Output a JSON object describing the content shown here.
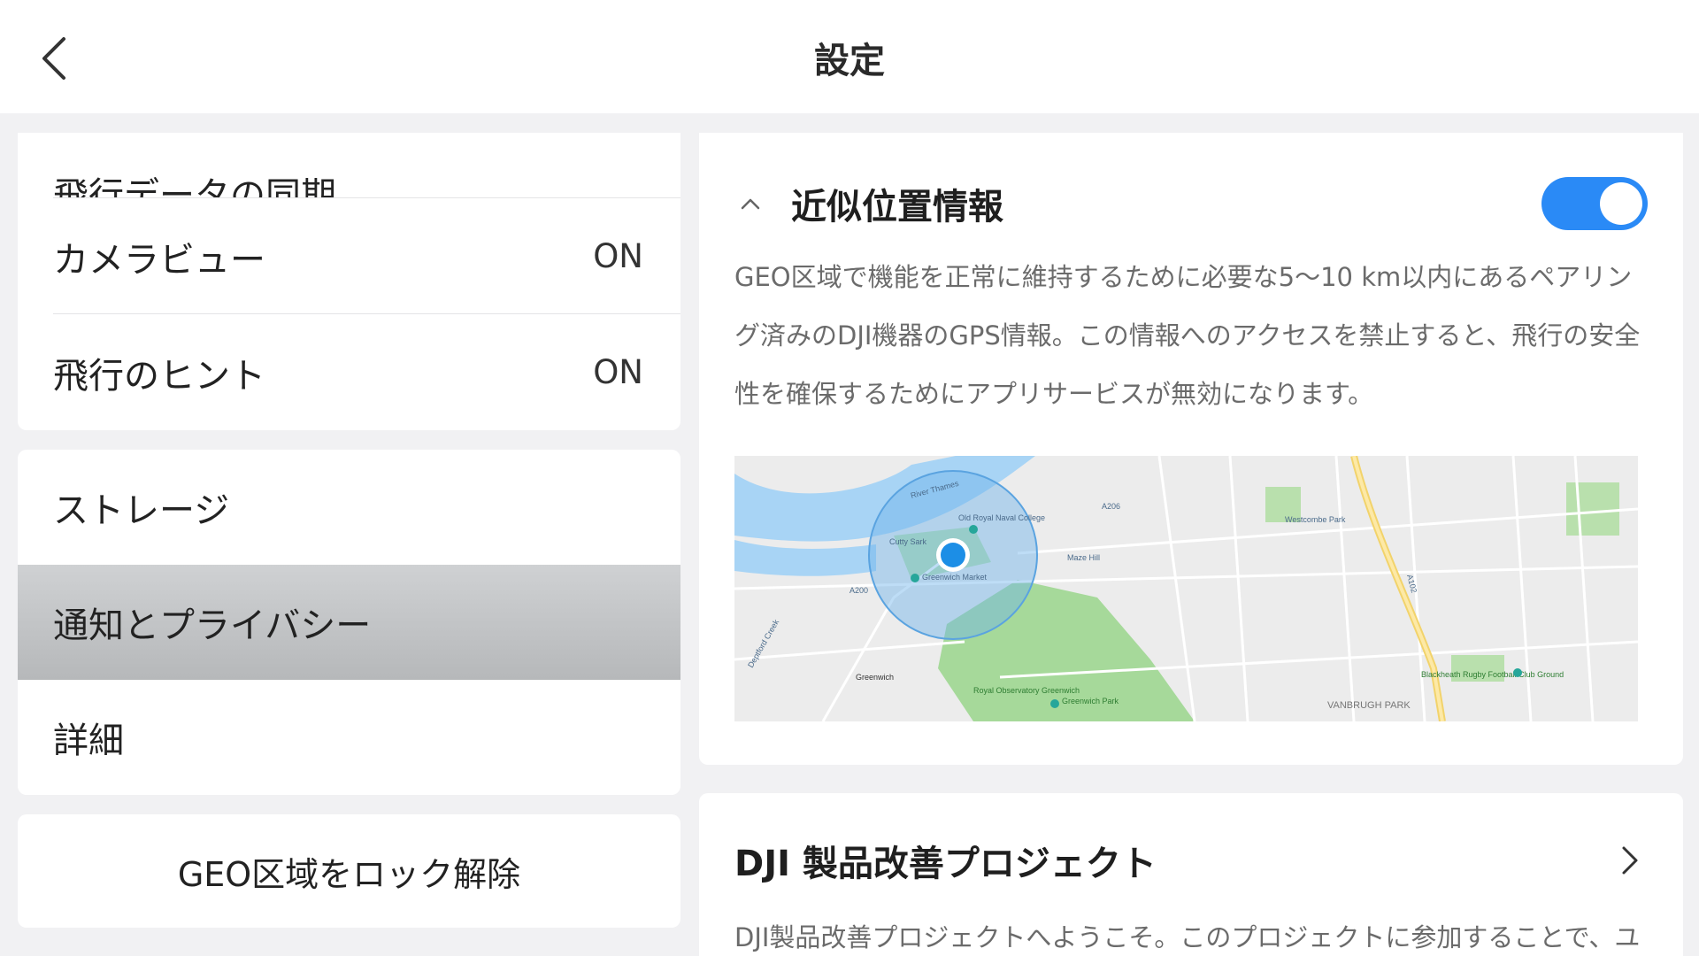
{
  "header": {
    "title": "設定",
    "back_icon": "chevron-left-icon"
  },
  "sidebar": {
    "group1": [
      {
        "label": "飛行データの同期",
        "value": ""
      },
      {
        "label": "カメラビュー",
        "value": "ON"
      },
      {
        "label": "飛行のヒント",
        "value": "ON"
      }
    ],
    "group2": [
      {
        "label": "ストレージ"
      },
      {
        "label": "通知とプライバシー",
        "selected": true
      },
      {
        "label": "詳細"
      }
    ],
    "unlock_button": "GEO区域をロック解除"
  },
  "location": {
    "title": "近似位置情報",
    "toggle_on": true,
    "description": "GEO区域で機能を正常に維持するために必要な5〜10 km以内にあるペアリング済みのDJI機器のGPS情報。この情報へのアクセスを禁止すると、飛行の安全性を確保するためにアプリサービスが無効になります。",
    "map_labels": {
      "thames": "River Thames",
      "naval_college": "Old Royal Naval College",
      "cutty_sark": "Cutty Sark",
      "market": "Greenwich Market",
      "maze_hill": "Maze Hill",
      "westcombe": "Westcombe Park",
      "a102": "A102",
      "a206": "A206",
      "a200": "A200",
      "greenwich": "Greenwich",
      "observatory": "Royal Observatory Greenwich",
      "park": "Greenwich Park",
      "rugby": "Blackheath Rugby Football Club Ground",
      "vanbrugh": "VANBRUGH PARK",
      "deptford": "Deptford Creek"
    }
  },
  "dji_project": {
    "title": "DJI 製品改善プロジェクト",
    "description": "DJI製品改善プロジェクトへようこそ。このプロジェクトに参加することで、ユ"
  },
  "colors": {
    "accent": "#2a8af6",
    "selected_row": "#c2c4c6",
    "park": "#a6d99a",
    "water": "#a8d4f5"
  }
}
